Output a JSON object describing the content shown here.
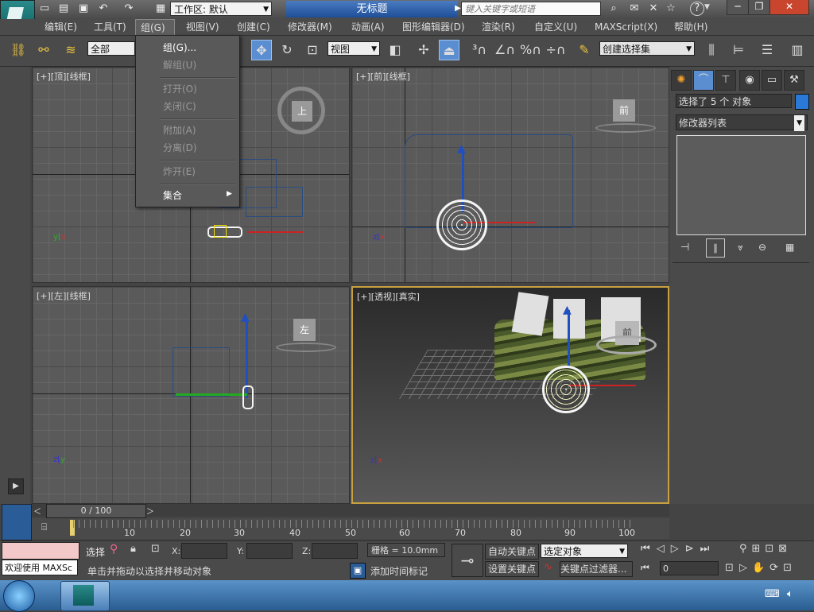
{
  "title_bar": {
    "workspace_label": "工作区: 默认",
    "doc_title": "无标题",
    "search_placeholder": "键入关键字或短语"
  },
  "menu_bar": {
    "items": [
      "编辑(E)",
      "工具(T)",
      "组(G)",
      "视图(V)",
      "创建(C)",
      "修改器(M)",
      "动画(A)",
      "图形编辑器(D)",
      "渲染(R)",
      "自定义(U)",
      "MAXScript(X)",
      "帮助(H)"
    ],
    "active": "组(G)"
  },
  "toolbar": {
    "filter_value": "全部",
    "refcoord_value": "视图",
    "selection_set_placeholder": "创建选择集"
  },
  "group_menu": {
    "items": [
      {
        "label": "组(G)...",
        "enabled": true
      },
      {
        "label": "解组(U)",
        "enabled": false
      },
      {
        "label": "打开(O)",
        "enabled": false
      },
      {
        "label": "关闭(C)",
        "enabled": false
      },
      {
        "label": "附加(A)",
        "enabled": false
      },
      {
        "label": "分离(D)",
        "enabled": false
      },
      {
        "label": "炸开(E)",
        "enabled": false
      },
      {
        "label": "集合",
        "enabled": true
      }
    ]
  },
  "viewports": {
    "top": {
      "label": "[+][顶][线框]",
      "cube": "上"
    },
    "front": {
      "label": "[+][前][线框]",
      "cube": "前"
    },
    "left": {
      "label": "[+][左][线框]",
      "cube": "左"
    },
    "persp": {
      "label": "[+][透视][真实]",
      "cube": "前"
    }
  },
  "command_panel": {
    "selection_text": "选择了 5 个 对象",
    "modifier_list": "修改器列表"
  },
  "timeline": {
    "frame_display": "0 / 100",
    "ticks": [
      "10",
      "20",
      "30",
      "40",
      "50",
      "60",
      "70",
      "80",
      "90",
      "100"
    ]
  },
  "status": {
    "maxscript_listener": "欢迎使用 MAXSc",
    "selection_lock": "选择",
    "x_label": "X:",
    "y_label": "Y:",
    "z_label": "Z:",
    "grid": "栅格 = 10.0mm",
    "prompt": "单击并拖动以选择并移动对象",
    "add_time_tag": "添加时间标记",
    "auto_key": "自动关键点",
    "set_key": "设置关键点",
    "key_mode": "选定对象",
    "key_filters": "关键点过滤器...",
    "frame_value": "0"
  },
  "colors": {
    "accent_blue": "#1e5aa8",
    "viewport_bg": "#5a5a5a",
    "persp_border": "#c8a040"
  }
}
